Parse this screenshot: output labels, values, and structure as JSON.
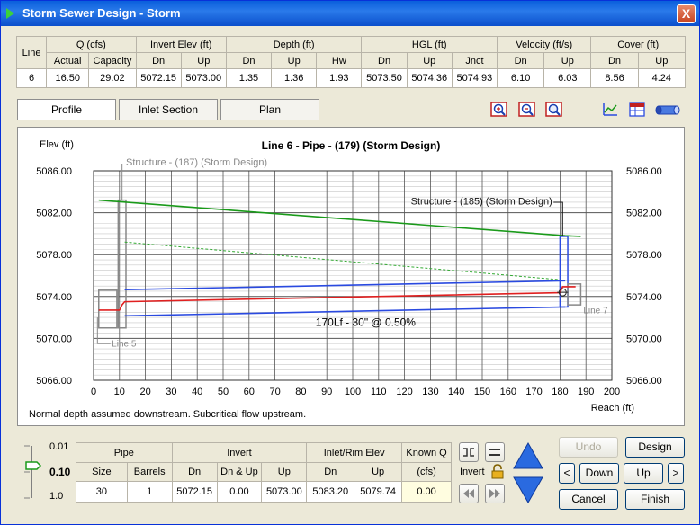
{
  "window": {
    "title": "Storm Sewer Design - Storm",
    "close_label": "X"
  },
  "summary_table": {
    "group_headers": {
      "line": "Line",
      "q": "Q (cfs)",
      "invert": "Invert Elev (ft)",
      "depth": "Depth (ft)",
      "hgl": "HGL (ft)",
      "velocity": "Velocity (ft/s)",
      "cover": "Cover (ft)"
    },
    "sub_headers": [
      "Actual",
      "Capacity",
      "Dn",
      "Up",
      "Dn",
      "Up",
      "Hw",
      "Dn",
      "Up",
      "Jnct",
      "Dn",
      "Up",
      "Dn",
      "Up"
    ],
    "row": [
      "6",
      "16.50",
      "29.02",
      "5072.15",
      "5073.00",
      "1.35",
      "1.36",
      "1.93",
      "5073.50",
      "5074.36",
      "5074.93",
      "6.10",
      "6.03",
      "8.56",
      "4.24"
    ]
  },
  "tabs": [
    "Profile",
    "Inlet Section",
    "Plan"
  ],
  "toolbar_icons": [
    "zoom-in-icon",
    "zoom-out-icon",
    "zoom-window-icon",
    "chart-options-icon",
    "data-table-icon",
    "pipe-3d-icon"
  ],
  "plot": {
    "y_axis_label": "Elev (ft)",
    "x_axis_label": "Reach (ft)",
    "footer_note": "Normal depth assumed downstream. Subcritical flow upstream.",
    "annotations": {
      "structure_187": "Structure - (187) (Storm Design)",
      "structure_185": "Structure - (185) (Storm Design)",
      "pipe_label": "170Lf - 30\" @ 0.50%",
      "line_5": "Line 5",
      "line_7": "Line 7"
    }
  },
  "chart_data": {
    "type": "line",
    "title": "Line 6 - Pipe - (179) (Storm Design)",
    "xlabel": "Reach (ft)",
    "ylabel": "Elev (ft)",
    "xlim": [
      0,
      200
    ],
    "ylim": [
      5066,
      5086
    ],
    "x_ticks": [
      "0",
      "10",
      "20",
      "30",
      "40",
      "50",
      "60",
      "70",
      "80",
      "90",
      "100",
      "110",
      "120",
      "130",
      "140",
      "150",
      "160",
      "170",
      "180",
      "190",
      "200"
    ],
    "y_ticks": [
      "5066.00",
      "5070.00",
      "5074.00",
      "5078.00",
      "5082.00",
      "5086.00"
    ],
    "grid": true,
    "series": [
      {
        "name": "Ground",
        "color": "#1a9a1a",
        "x": [
          2,
          182,
          188
        ],
        "y": [
          5083.2,
          5079.8,
          5079.74
        ]
      },
      {
        "name": "Energy grade",
        "color": "#33aa33",
        "dashed": true,
        "x": [
          12,
          180
        ],
        "y": [
          5079.2,
          5075.6
        ]
      },
      {
        "name": "HGL",
        "color": "#e02020",
        "x": [
          2,
          10,
          11,
          12,
          180,
          181,
          186
        ],
        "y": [
          5072.7,
          5072.7,
          5073.2,
          5073.5,
          5074.36,
          5074.93,
          5074.93
        ]
      },
      {
        "name": "Pipe crown",
        "color": "#2a4ae0",
        "x": [
          12,
          182
        ],
        "y": [
          5074.65,
          5075.5
        ]
      },
      {
        "name": "Pipe invert",
        "color": "#2a4ae0",
        "x": [
          12,
          182
        ],
        "y": [
          5072.15,
          5073.0
        ]
      }
    ]
  },
  "bottom_panel": {
    "scale_labels": [
      "0.01",
      "0.10",
      "1.0"
    ],
    "group_headers": {
      "pipe": "Pipe",
      "invert": "Invert",
      "rim": "Inlet/Rim Elev",
      "known_q": "Known Q"
    },
    "sub_headers": [
      "Size",
      "Barrels",
      "Dn",
      "Dn & Up",
      "Up",
      "Dn",
      "Up",
      "(cfs)"
    ],
    "row": [
      "30",
      "1",
      "5072.15",
      "0.00",
      "5073.00",
      "5083.20",
      "5079.74",
      "0.00"
    ],
    "invert_label": "Invert"
  },
  "buttons": {
    "undo": "Undo",
    "design": "Design",
    "prev": "<",
    "down": "Down",
    "up": "Up",
    "next": ">",
    "cancel": "Cancel",
    "finish": "Finish"
  }
}
